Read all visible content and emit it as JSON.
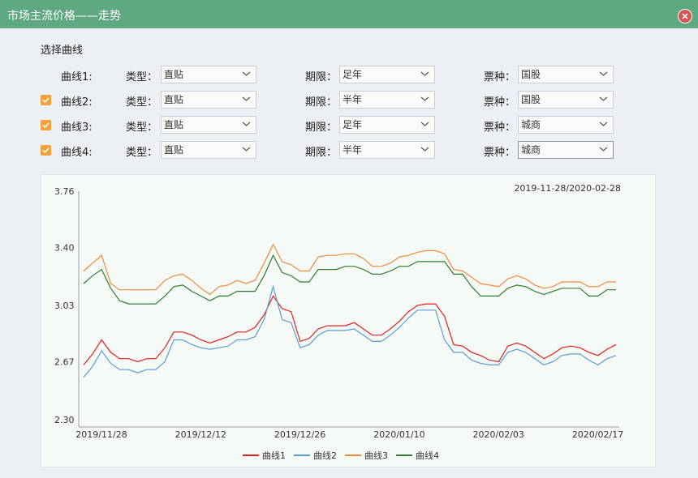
{
  "window": {
    "title": "市场主流价格——走势",
    "close_icon": "close-icon",
    "accent_color": "#5fa982"
  },
  "form": {
    "section_label": "选择曲线",
    "type_label": "类型：",
    "term_label": "期限：",
    "kind_label": "票种：",
    "rows": [
      {
        "curve": "曲线1:",
        "checked": false,
        "type": "直贴",
        "term": "足年",
        "kind": "国股"
      },
      {
        "curve": "曲线2:",
        "checked": true,
        "type": "直贴",
        "term": "半年",
        "kind": "国股"
      },
      {
        "curve": "曲线3:",
        "checked": true,
        "type": "直贴",
        "term": "足年",
        "kind": "城商"
      },
      {
        "curve": "曲线4:",
        "checked": true,
        "type": "直贴",
        "term": "半年",
        "kind": "城商"
      }
    ]
  },
  "chart_data": {
    "type": "line",
    "date_range": "2019-11-28/2020-02-28",
    "ylim": [
      2.3,
      3.76
    ],
    "yticks": [
      "3.76",
      "3.40",
      "3.03",
      "2.67",
      "2.30"
    ],
    "xticks": [
      "2019/11/28",
      "2019/12/12",
      "2019/12/26",
      "2020/01/10",
      "2020/02/03",
      "2020/02/17"
    ],
    "grid": false,
    "legend_position": "bottom",
    "series": [
      {
        "name": "曲线1",
        "color": "#e0201c",
        "values": [
          2.65,
          2.72,
          2.81,
          2.73,
          2.69,
          2.69,
          2.67,
          2.69,
          2.69,
          2.76,
          2.86,
          2.86,
          2.84,
          2.81,
          2.79,
          2.81,
          2.83,
          2.86,
          2.86,
          2.89,
          2.97,
          3.09,
          3.01,
          2.99,
          2.8,
          2.82,
          2.88,
          2.9,
          2.9,
          2.9,
          2.92,
          2.88,
          2.84,
          2.84,
          2.88,
          2.93,
          2.99,
          3.03,
          3.04,
          3.04,
          2.96,
          2.78,
          2.77,
          2.73,
          2.71,
          2.68,
          2.67,
          2.77,
          2.79,
          2.77,
          2.73,
          2.69,
          2.72,
          2.76,
          2.77,
          2.76,
          2.73,
          2.71,
          2.75,
          2.78
        ]
      },
      {
        "name": "曲线2",
        "color": "#5b9bd5",
        "values": [
          2.57,
          2.64,
          2.74,
          2.66,
          2.62,
          2.62,
          2.6,
          2.62,
          2.62,
          2.67,
          2.81,
          2.81,
          2.78,
          2.76,
          2.75,
          2.76,
          2.77,
          2.81,
          2.81,
          2.83,
          2.94,
          3.15,
          2.94,
          2.92,
          2.76,
          2.78,
          2.84,
          2.87,
          2.87,
          2.87,
          2.88,
          2.84,
          2.8,
          2.8,
          2.84,
          2.89,
          2.95,
          3.0,
          3.0,
          3.0,
          2.81,
          2.73,
          2.73,
          2.68,
          2.66,
          2.65,
          2.65,
          2.73,
          2.75,
          2.73,
          2.69,
          2.65,
          2.67,
          2.71,
          2.72,
          2.72,
          2.68,
          2.65,
          2.69,
          2.71
        ]
      },
      {
        "name": "曲线3",
        "color": "#ee8a3d",
        "values": [
          3.25,
          3.3,
          3.35,
          3.17,
          3.13,
          3.13,
          3.13,
          3.13,
          3.13,
          3.19,
          3.22,
          3.23,
          3.19,
          3.14,
          3.1,
          3.15,
          3.16,
          3.19,
          3.17,
          3.19,
          3.3,
          3.42,
          3.31,
          3.29,
          3.25,
          3.25,
          3.34,
          3.35,
          3.35,
          3.36,
          3.36,
          3.33,
          3.28,
          3.28,
          3.3,
          3.34,
          3.35,
          3.37,
          3.38,
          3.38,
          3.36,
          3.26,
          3.25,
          3.21,
          3.17,
          3.16,
          3.15,
          3.2,
          3.22,
          3.2,
          3.16,
          3.14,
          3.15,
          3.18,
          3.18,
          3.18,
          3.15,
          3.15,
          3.18,
          3.18
        ]
      },
      {
        "name": "曲线4",
        "color": "#2e7d32",
        "values": [
          3.17,
          3.22,
          3.26,
          3.14,
          3.06,
          3.04,
          3.04,
          3.04,
          3.04,
          3.09,
          3.15,
          3.16,
          3.12,
          3.09,
          3.06,
          3.09,
          3.09,
          3.12,
          3.12,
          3.12,
          3.22,
          3.35,
          3.24,
          3.22,
          3.18,
          3.18,
          3.26,
          3.26,
          3.26,
          3.28,
          3.28,
          3.26,
          3.23,
          3.23,
          3.25,
          3.28,
          3.28,
          3.31,
          3.31,
          3.31,
          3.31,
          3.23,
          3.23,
          3.15,
          3.09,
          3.09,
          3.09,
          3.14,
          3.16,
          3.15,
          3.12,
          3.1,
          3.12,
          3.14,
          3.14,
          3.14,
          3.09,
          3.09,
          3.13,
          3.13
        ]
      }
    ]
  }
}
